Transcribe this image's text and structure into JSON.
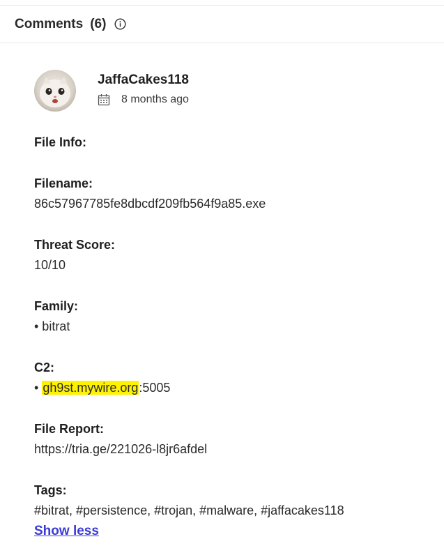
{
  "header": {
    "title": "Comments",
    "count": "(6)"
  },
  "comment": {
    "author": "JaffaCakes118",
    "date": "8 months ago",
    "file_info_label": "File Info:",
    "filename_label": "Filename:",
    "filename_value": "86c57967785fe8dbcdf209fb564f9a85.exe",
    "threat_label": "Threat Score:",
    "threat_value": "10/10",
    "family_label": "Family:",
    "family_value": "• bitrat",
    "c2_label": "C2:",
    "c2_bullet": "• ",
    "c2_host": "gh9st.mywire.org",
    "c2_port": ":5005",
    "report_label": "File Report:",
    "report_value": "https://tria.ge/221026-l8jr6afdel",
    "tags_label": "Tags:",
    "tags_value": "#bitrat, #persistence, #trojan, #malware, #jaffacakes118",
    "show_less": "Show less"
  },
  "colors": {
    "highlight": "#fff200",
    "link": "#3a3ad6"
  },
  "icons": {
    "info": "info-icon",
    "calendar": "calendar-icon",
    "avatar": "cat-avatar"
  }
}
